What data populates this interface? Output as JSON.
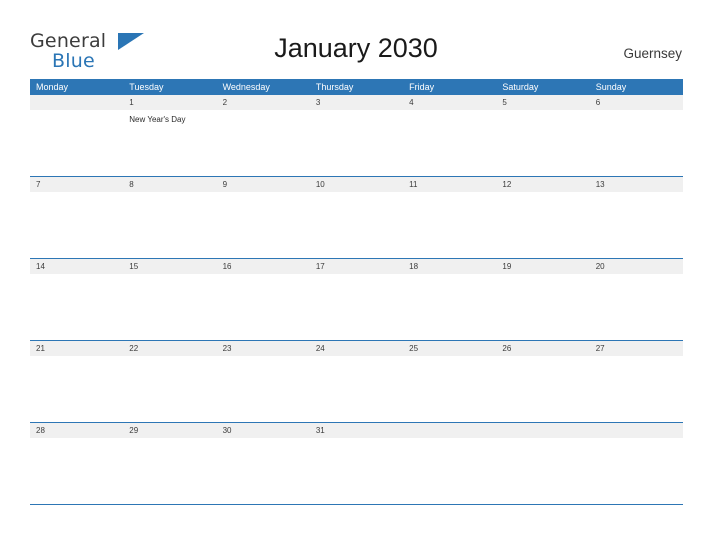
{
  "brand": {
    "word_general": "General",
    "word_blue": "Blue",
    "flag_icon": "flag-triangle-icon",
    "accent_color": "#2d76b5"
  },
  "header": {
    "title": "January 2030",
    "region": "Guernsey"
  },
  "calendar": {
    "day_headers": [
      "Monday",
      "Tuesday",
      "Wednesday",
      "Thursday",
      "Friday",
      "Saturday",
      "Sunday"
    ],
    "weeks": [
      [
        {
          "num": "",
          "event": ""
        },
        {
          "num": "1",
          "event": "New Year's Day"
        },
        {
          "num": "2",
          "event": ""
        },
        {
          "num": "3",
          "event": ""
        },
        {
          "num": "4",
          "event": ""
        },
        {
          "num": "5",
          "event": ""
        },
        {
          "num": "6",
          "event": ""
        }
      ],
      [
        {
          "num": "7",
          "event": ""
        },
        {
          "num": "8",
          "event": ""
        },
        {
          "num": "9",
          "event": ""
        },
        {
          "num": "10",
          "event": ""
        },
        {
          "num": "11",
          "event": ""
        },
        {
          "num": "12",
          "event": ""
        },
        {
          "num": "13",
          "event": ""
        }
      ],
      [
        {
          "num": "14",
          "event": ""
        },
        {
          "num": "15",
          "event": ""
        },
        {
          "num": "16",
          "event": ""
        },
        {
          "num": "17",
          "event": ""
        },
        {
          "num": "18",
          "event": ""
        },
        {
          "num": "19",
          "event": ""
        },
        {
          "num": "20",
          "event": ""
        }
      ],
      [
        {
          "num": "21",
          "event": ""
        },
        {
          "num": "22",
          "event": ""
        },
        {
          "num": "23",
          "event": ""
        },
        {
          "num": "24",
          "event": ""
        },
        {
          "num": "25",
          "event": ""
        },
        {
          "num": "26",
          "event": ""
        },
        {
          "num": "27",
          "event": ""
        }
      ],
      [
        {
          "num": "28",
          "event": ""
        },
        {
          "num": "29",
          "event": ""
        },
        {
          "num": "30",
          "event": ""
        },
        {
          "num": "31",
          "event": ""
        },
        {
          "num": "",
          "event": ""
        },
        {
          "num": "",
          "event": ""
        },
        {
          "num": "",
          "event": ""
        }
      ]
    ]
  }
}
